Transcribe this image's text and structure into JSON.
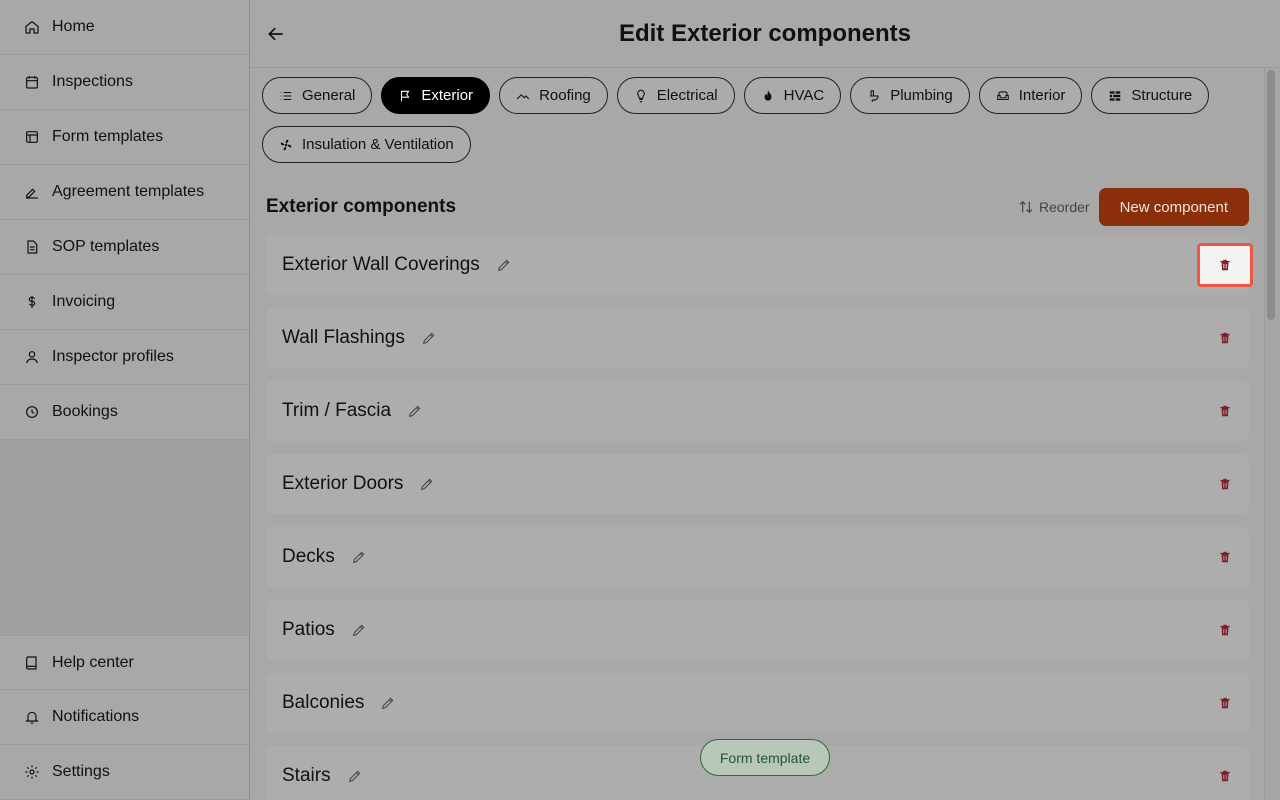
{
  "sidebar": {
    "top_items": [
      {
        "label": "Home",
        "icon": "home-icon"
      },
      {
        "label": "Inspections",
        "icon": "calendar-icon"
      },
      {
        "label": "Form templates",
        "icon": "layout-icon"
      },
      {
        "label": "Agreement templates",
        "icon": "signature-icon"
      },
      {
        "label": "SOP templates",
        "icon": "document-icon"
      },
      {
        "label": "Invoicing",
        "icon": "dollar-icon"
      },
      {
        "label": "Inspector profiles",
        "icon": "user-icon"
      },
      {
        "label": "Bookings",
        "icon": "clock-icon"
      }
    ],
    "bottom_items": [
      {
        "label": "Help center",
        "icon": "book-icon"
      },
      {
        "label": "Notifications",
        "icon": "bell-icon"
      },
      {
        "label": "Settings",
        "icon": "gear-icon"
      }
    ]
  },
  "header": {
    "title": "Edit Exterior components"
  },
  "tabs": [
    {
      "label": "General",
      "icon": "list-icon",
      "active": false
    },
    {
      "label": "Exterior",
      "icon": "sign-icon",
      "active": true
    },
    {
      "label": "Roofing",
      "icon": "roof-icon",
      "active": false
    },
    {
      "label": "Electrical",
      "icon": "bulb-icon",
      "active": false
    },
    {
      "label": "HVAC",
      "icon": "flame-icon",
      "active": false
    },
    {
      "label": "Plumbing",
      "icon": "toilet-icon",
      "active": false
    },
    {
      "label": "Interior",
      "icon": "sofa-icon",
      "active": false
    },
    {
      "label": "Structure",
      "icon": "brick-icon",
      "active": false
    },
    {
      "label": "Insulation & Ventilation",
      "icon": "fan-icon",
      "active": false
    }
  ],
  "section": {
    "title": "Exterior components",
    "reorder_label": "Reorder",
    "new_label": "New component"
  },
  "components": [
    "Exterior Wall Coverings",
    "Wall Flashings",
    "Trim / Fascia",
    "Exterior Doors",
    "Decks",
    "Patios",
    "Balconies",
    "Stairs"
  ],
  "floating": {
    "label": "Form template"
  },
  "colors": {
    "accent": "#8a2f09",
    "trash": "#7a1f2a",
    "focus": "#ee5644",
    "floating": "#1e5a2c"
  }
}
